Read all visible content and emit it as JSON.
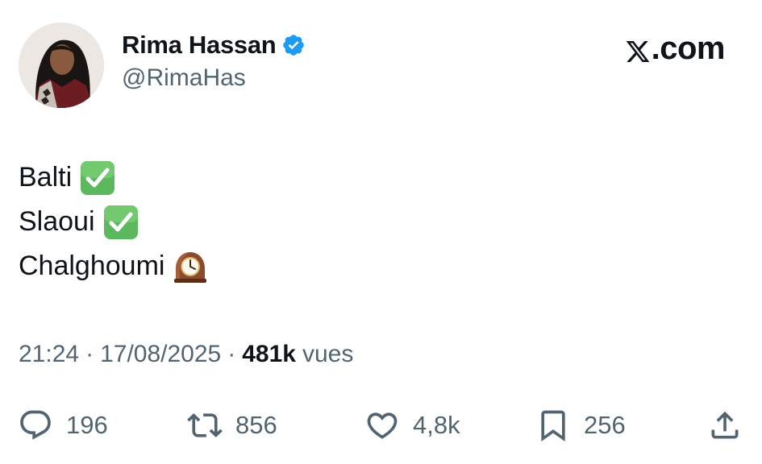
{
  "author": {
    "display_name": "Rima Hassan",
    "handle": "@RimaHas",
    "verified_icon": "verified-badge-icon"
  },
  "brand": {
    "label": ".com",
    "icon": "x-logo-icon"
  },
  "tweet": {
    "lines": [
      {
        "text": "Balti",
        "emoji": "check-mark-button-emoji"
      },
      {
        "text": "Slaoui",
        "emoji": "check-mark-button-emoji"
      },
      {
        "text": "Chalghoumi",
        "emoji": "mantelpiece-clock-emoji"
      }
    ]
  },
  "meta": {
    "time": "21:24",
    "separator": "·",
    "date": "17/08/2025",
    "views_count": "481k",
    "views_label": "vues"
  },
  "actions": {
    "replies": "196",
    "reposts": "856",
    "likes": "4,8k",
    "bookmarks": "256"
  },
  "colors": {
    "text": "#0f1419",
    "secondary": "#536471",
    "verified": "#1d9bf0",
    "check_emoji": "#5cb85c"
  }
}
